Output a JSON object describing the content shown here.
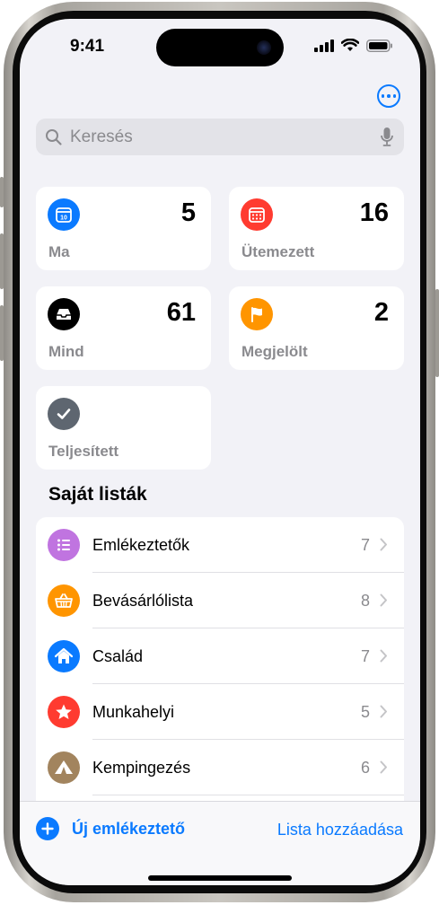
{
  "status": {
    "time": "9:41"
  },
  "search": {
    "placeholder": "Keresés"
  },
  "smart_lists": [
    {
      "label": "Ma",
      "count": "5",
      "icon": "calendar-today-icon",
      "color": "#0a7aff",
      "glyph_text": "10"
    },
    {
      "label": "Ütemezett",
      "count": "16",
      "icon": "calendar-scheduled-icon",
      "color": "#ff3b30"
    },
    {
      "label": "Mind",
      "count": "61",
      "icon": "tray-icon",
      "color": "#000000"
    },
    {
      "label": "Megjelölt",
      "count": "2",
      "icon": "flag-icon",
      "color": "#ff9500"
    },
    {
      "label": "Teljesített",
      "icon": "checkmark-icon",
      "color": "#5e6670"
    }
  ],
  "my_lists": {
    "title": "Saját listák",
    "items": [
      {
        "name": "Emlékeztetők",
        "count": "7",
        "icon": "list-bullet-icon",
        "color": "#c074e0"
      },
      {
        "name": "Bevásárlólista",
        "count": "8",
        "icon": "basket-icon",
        "color": "#ff9500"
      },
      {
        "name": "Család",
        "count": "7",
        "icon": "house-icon",
        "color": "#0a7aff"
      },
      {
        "name": "Munkahelyi",
        "count": "5",
        "icon": "star-icon",
        "color": "#ff3b30"
      },
      {
        "name": "Kempingezés",
        "count": "6",
        "icon": "tent-icon",
        "color": "#a2845e"
      }
    ]
  },
  "toolbar": {
    "new_reminder_label": "Új emlékeztető",
    "add_list_label": "Lista hozzáadása"
  },
  "colors": {
    "accent": "#0a7aff",
    "background": "#f2f2f7"
  }
}
